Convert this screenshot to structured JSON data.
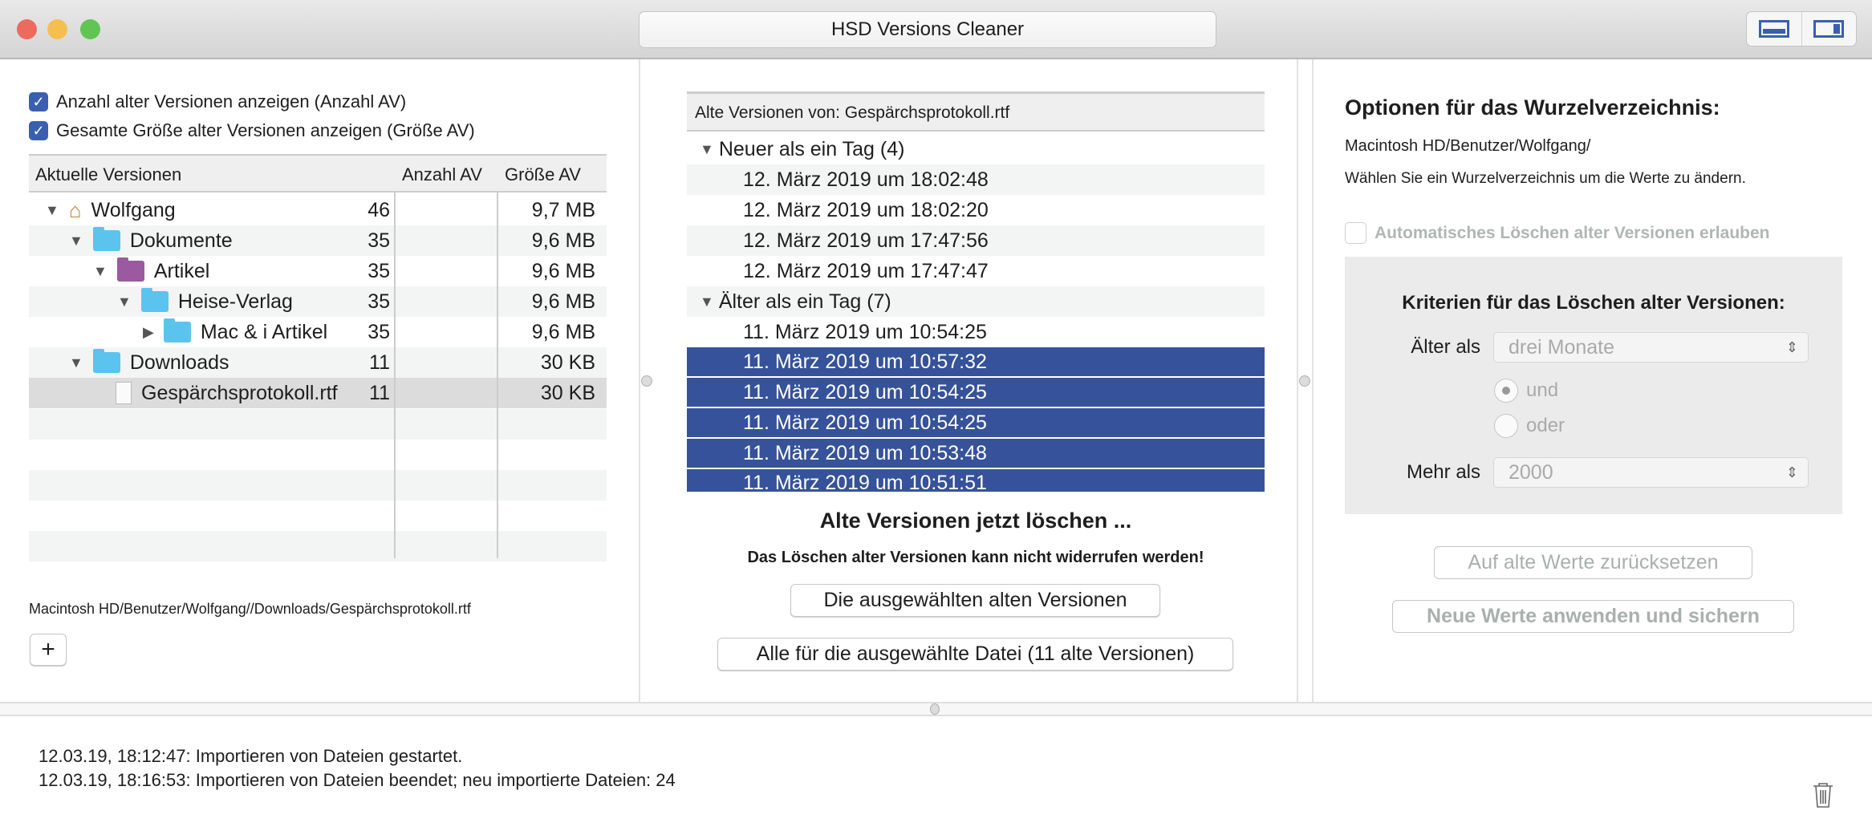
{
  "window": {
    "title": "HSD Versions Cleaner"
  },
  "left": {
    "checkbox1": "Anzahl alter Versionen anzeigen (Anzahl AV)",
    "checkbox2": "Gesamte Größe alter Versionen anzeigen (Größe AV)",
    "columns": [
      "Aktuelle Versionen",
      "Anzahl AV",
      "Größe AV"
    ],
    "rows": [
      {
        "name": "Wolfgang",
        "count": "46",
        "size": "9,7 MB"
      },
      {
        "name": "Dokumente",
        "count": "35",
        "size": "9,6 MB"
      },
      {
        "name": "Artikel",
        "count": "35",
        "size": "9,6 MB"
      },
      {
        "name": "Heise-Verlag",
        "count": "35",
        "size": "9,6 MB"
      },
      {
        "name": "Mac & i Artikel",
        "count": "35",
        "size": "9,6 MB"
      },
      {
        "name": "Downloads",
        "count": "11",
        "size": "30 KB"
      },
      {
        "name": "Gespärchsprotokoll.rtf",
        "count": "11",
        "size": "30 KB"
      }
    ],
    "path": "Macintosh HD/Benutzer/Wolfgang//Downloads/Gespärchsprotokoll.rtf",
    "add_label": "+"
  },
  "center": {
    "header": "Alte Versionen von: Gespärchsprotokoll.rtf",
    "group1": "Neuer als ein Tag (4)",
    "group1_items": [
      "12. März 2019 um 18:02:48",
      "12. März 2019 um 18:02:20",
      "12. März 2019 um 17:47:56",
      "12. März 2019 um 17:47:47"
    ],
    "group2": "Älter als ein Tag (7)",
    "group2_items": [
      "11. März 2019 um 10:54:25",
      "11. März 2019 um 10:57:32",
      "11. März 2019 um 10:54:25",
      "11. März 2019 um 10:54:25",
      "11. März 2019 um 10:53:48",
      "11. März 2019 um 10:51:51"
    ],
    "delete_title": "Alte Versionen jetzt löschen ...",
    "warning": "Das Löschen alter Versionen kann nicht widerrufen werden!",
    "btn_selected": "Die ausgewählten alten Versionen",
    "btn_all": "Alle für die ausgewählte Datei (11 alte Versionen)"
  },
  "right": {
    "heading": "Optionen für das Wurzelverzeichnis:",
    "path": "Macintosh HD/Benutzer/Wolfgang/",
    "hint": "Wählen Sie ein Wurzelverzeichnis um die Werte zu ändern.",
    "auto_delete": "Automatisches Löschen alter Versionen erlauben",
    "criteria_heading": "Kriterien für das Löschen alter Versionen:",
    "older_label": "Älter als",
    "older_value": "drei Monate",
    "radio_and": "und",
    "radio_or": "oder",
    "more_label": "Mehr als",
    "more_value": "2000",
    "reset_btn": "Auf alte Werte zurücksetzen",
    "apply_btn": "Neue Werte anwenden und sichern"
  },
  "log": {
    "lines": [
      "12.03.19, 18:12:47: Importieren von Dateien gestartet.",
      "12.03.19, 18:16:53: Importieren von Dateien beendet; neu importierte Dateien: 24"
    ]
  },
  "colors": {
    "selection": "#36529a",
    "checkbox": "#3a5fb0"
  }
}
